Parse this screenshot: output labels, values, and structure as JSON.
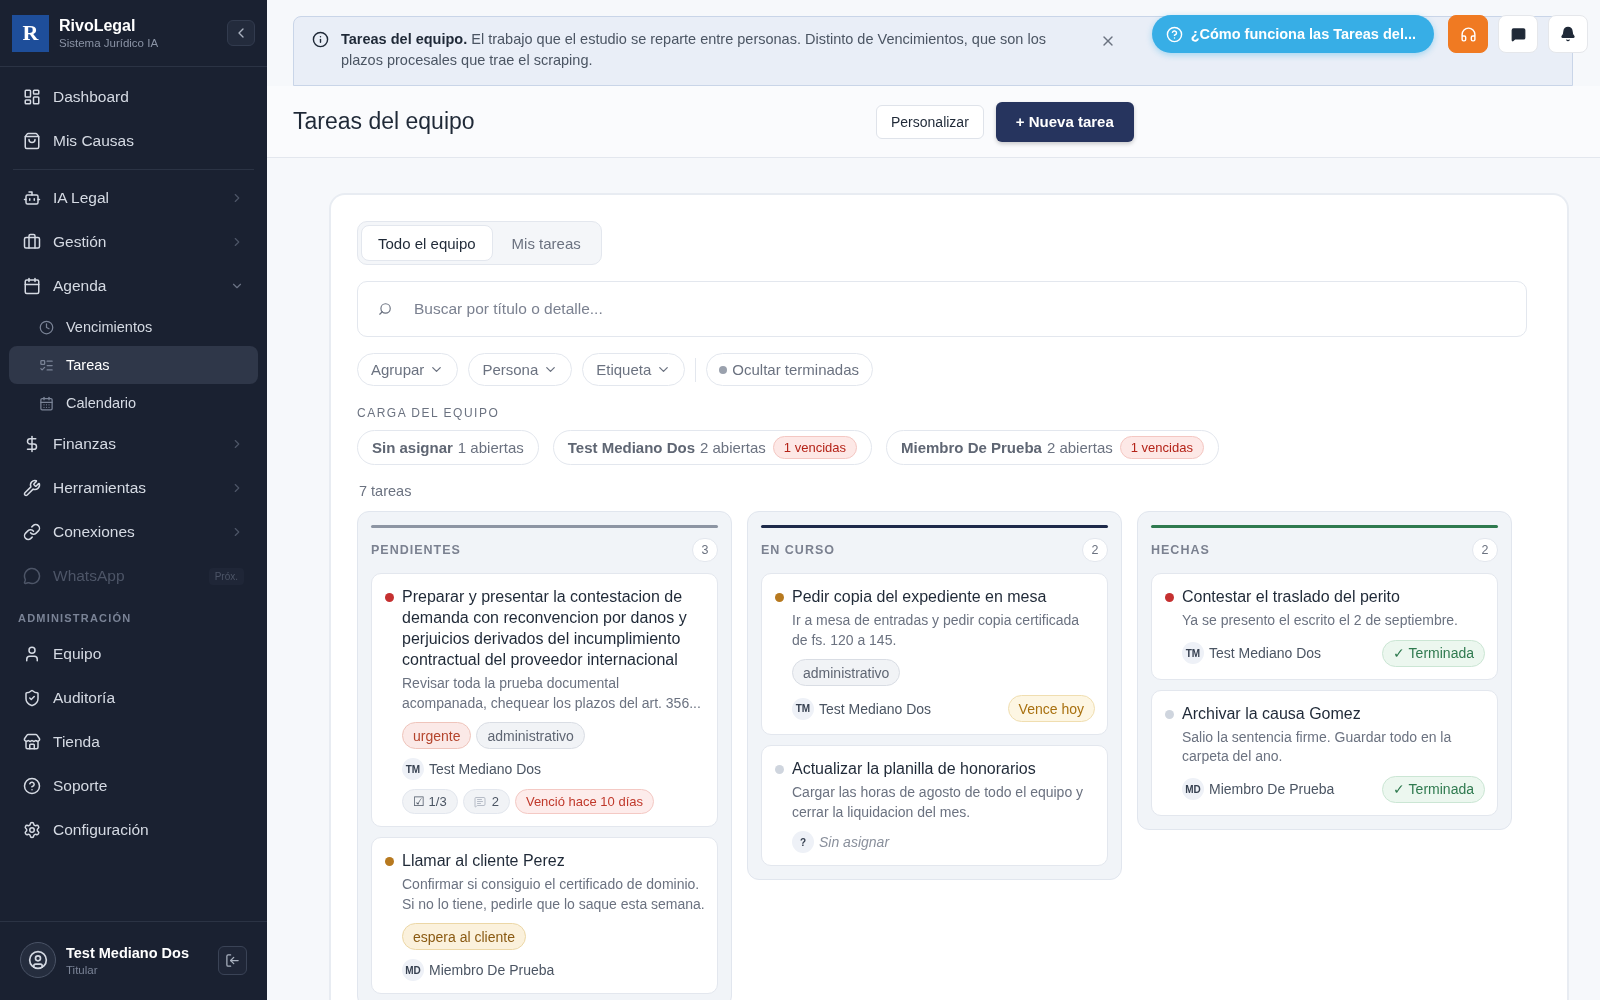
{
  "sidebar": {
    "brand": {
      "logo": "R",
      "name": "RivoLegal",
      "subtitle": "Sistema Jurídico IA"
    },
    "items": [
      {
        "kind": "item",
        "label": "Dashboard",
        "selected": false
      },
      {
        "kind": "item",
        "label": "Mis Causas",
        "selected": false
      },
      {
        "kind": "divider"
      },
      {
        "kind": "group",
        "label": "IA Legal",
        "expanded": false
      },
      {
        "kind": "group",
        "label": "Gestión",
        "expanded": false
      },
      {
        "kind": "group",
        "label": "Agenda",
        "expanded": true,
        "children": [
          {
            "label": "Vencimientos",
            "selected": false
          },
          {
            "label": "Tareas",
            "selected": true
          },
          {
            "label": "Calendario",
            "selected": false
          }
        ]
      },
      {
        "kind": "group",
        "label": "Finanzas",
        "expanded": false
      },
      {
        "kind": "group",
        "label": "Herramientas",
        "expanded": false
      },
      {
        "kind": "group",
        "label": "Conexiones",
        "expanded": false
      },
      {
        "kind": "soon",
        "label": "WhatsApp",
        "badge": "Próx.",
        "disabled": true
      },
      {
        "kind": "section",
        "label": "ADMINISTRACIÓN"
      },
      {
        "kind": "item",
        "label": "Equipo",
        "selected": false
      },
      {
        "kind": "item",
        "label": "Auditoría",
        "selected": false
      },
      {
        "kind": "item",
        "label": "Tienda",
        "selected": false
      },
      {
        "kind": "item",
        "label": "Soporte",
        "selected": false
      },
      {
        "kind": "item",
        "label": "Configuración",
        "selected": false
      }
    ],
    "user": {
      "name": "Test Mediano Dos",
      "role": "Titular"
    }
  },
  "banner": {
    "text": "**Tareas del equipo.** El trabajo que el estudio se reparte entre personas. Distinto de Vencimientos, que son los plazos procesales que trae el scraping."
  },
  "help_button": "¿Cómo funciona las Tareas del...",
  "header": {
    "title": "Tareas del equipo",
    "buttons": [
      {
        "label": "Personalizar",
        "kind": "secondary"
      },
      {
        "label": "+ Nueva tarea",
        "kind": "primary"
      }
    ]
  },
  "tabs": [
    {
      "label": "Todo el equipo",
      "selected": true
    },
    {
      "label": "Mis tareas",
      "selected": false
    }
  ],
  "search": {
    "placeholder": "Buscar por título o detalle..."
  },
  "filters": [
    {
      "label": "Agrupar"
    },
    {
      "label": "Persona"
    },
    {
      "label": "Etiqueta"
    }
  ],
  "hide_done": {
    "label": "Ocultar terminadas",
    "on": false
  },
  "workload": {
    "title": "CARGA DEL EQUIPO",
    "people": [
      {
        "name": "Sin asignar",
        "open": "1 abiertas"
      },
      {
        "name": "Test Mediano Dos",
        "open": "2 abiertas",
        "overdue": "1 vencidas"
      },
      {
        "name": "Miembro De Prueba",
        "open": "2 abiertas",
        "overdue": "1 vencidas"
      }
    ]
  },
  "count": "7 tareas",
  "columns": [
    {
      "title": "PENDIENTES",
      "count": "3",
      "color": "#8d95a3",
      "cards": [
        {
          "title": "Preparar y presentar la contestacion de demanda con reconvencion por danos y perjuicios derivados del incumplimiento contractual del proveedor internacional",
          "color": "#c53030",
          "description": "Revisar toda la prueba documental acompanada, chequear los plazos del art. 356...",
          "tags": [
            {
              "label": "urgente",
              "kind": "urgent"
            },
            {
              "label": "administrativo",
              "kind": "neutral"
            }
          ],
          "assignee": {
            "initials": "TM",
            "name": "Test Mediano Dos",
            "unassigned": false
          },
          "checklist": "☑ 1/3",
          "comments": "2",
          "due": {
            "label": "Venció hace 10 días",
            "kind": "overdue"
          }
        },
        {
          "title": "Llamar al cliente Perez",
          "color": "#b7791f",
          "description": "Confirmar si consiguio el certificado de dominio. Si no lo tiene, pedirle que lo saque esta semana.",
          "tags": [
            {
              "label": "espera al cliente",
              "kind": "waiting"
            }
          ],
          "assignee": {
            "initials": "MD",
            "name": "Miembro De Prueba",
            "unassigned": false
          }
        }
      ]
    },
    {
      "title": "EN CURSO",
      "count": "2",
      "color": "#1e2a4a",
      "cards": [
        {
          "title": "Pedir copia del expediente en mesa",
          "color": "#b7791f",
          "description": "Ir a mesa de entradas y pedir copia certificada de fs. 120 a 145.",
          "tags": [
            {
              "label": "administrativo",
              "kind": "neutral"
            }
          ],
          "assignee": {
            "initials": "TM",
            "name": "Test Mediano Dos",
            "unassigned": false
          },
          "due": {
            "label": "Vence hoy",
            "kind": "today"
          }
        },
        {
          "title": "Actualizar la planilla de honorarios",
          "color": "#cfd5de",
          "description": "Cargar las horas de agosto de todo el equipo y cerrar la liquidacion del mes.",
          "assignee": {
            "initials": "?",
            "name": "Sin asignar",
            "unassigned": true
          }
        }
      ]
    },
    {
      "title": "HECHAS",
      "count": "2",
      "color": "#2f7a4f",
      "cards": [
        {
          "title": "Contestar el traslado del perito",
          "color": "#c53030",
          "description": "Ya se presento el escrito el 2 de septiembre.",
          "assignee": {
            "initials": "TM",
            "name": "Test Mediano Dos",
            "unassigned": false
          },
          "due": {
            "label": "✓ Terminada",
            "kind": "done"
          }
        },
        {
          "title": "Archivar la causa Gomez",
          "color": "#cfd5de",
          "description": "Salio la sentencia firme. Guardar todo en la carpeta del ano.",
          "assignee": {
            "initials": "MD",
            "name": "Miembro De Prueba",
            "unassigned": false
          },
          "due": {
            "label": "✓ Terminada",
            "kind": "done"
          }
        }
      ]
    }
  ]
}
